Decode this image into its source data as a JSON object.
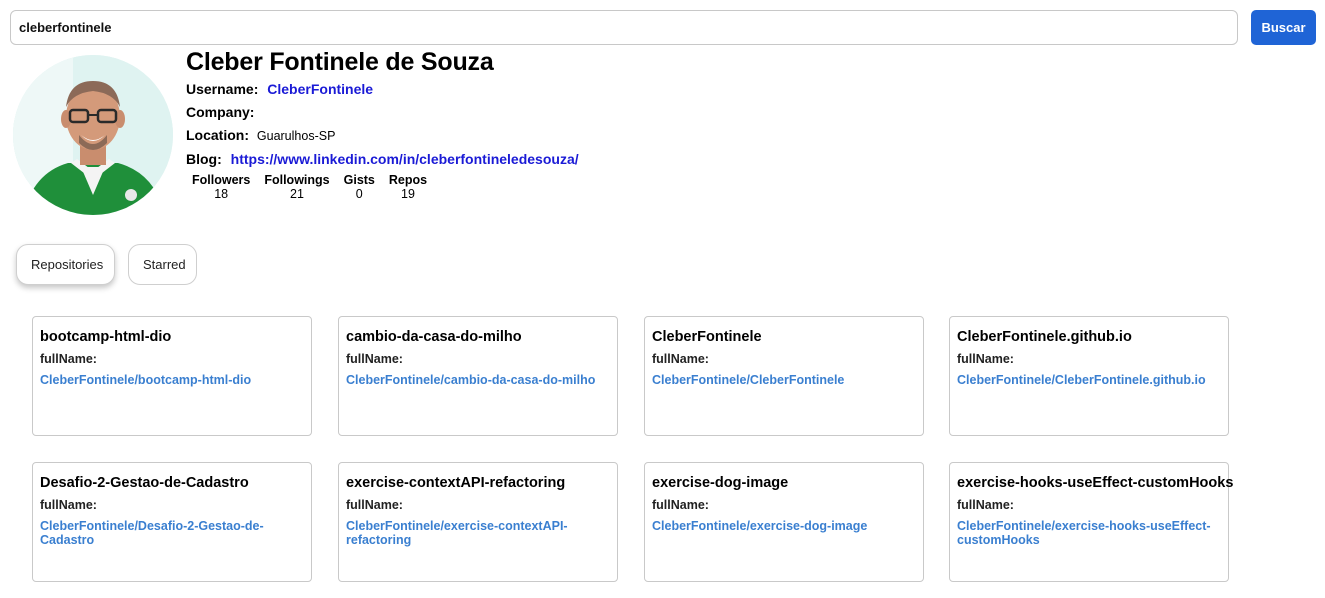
{
  "search": {
    "value": "cleberfontinele",
    "placeholder": "",
    "button_label": "Buscar"
  },
  "profile": {
    "name": "Cleber Fontinele de Souza",
    "username_label": "Username:",
    "username": "CleberFontinele",
    "company_label": "Company:",
    "company": "",
    "location_label": "Location:",
    "location": "Guarulhos-SP",
    "blog_label": "Blog:",
    "blog": "https://www.linkedin.com/in/cleberfontineledesouza/"
  },
  "stats": [
    {
      "label": "Followers",
      "value": "18"
    },
    {
      "label": "Followings",
      "value": "21"
    },
    {
      "label": "Gists",
      "value": "0"
    },
    {
      "label": "Repos",
      "value": "19"
    }
  ],
  "tabs": [
    {
      "label": "Repositories",
      "active": true
    },
    {
      "label": "Starred",
      "active": false
    }
  ],
  "repos": [
    {
      "name": "bootcamp-html-dio",
      "full_label": "fullName:",
      "full_name": "CleberFontinele/bootcamp-html-dio"
    },
    {
      "name": "cambio-da-casa-do-milho",
      "full_label": "fullName:",
      "full_name": "CleberFontinele/cambio-da-casa-do-milho"
    },
    {
      "name": "CleberFontinele",
      "full_label": "fullName:",
      "full_name": "CleberFontinele/CleberFontinele"
    },
    {
      "name": "CleberFontinele.github.io",
      "full_label": "fullName:",
      "full_name": "CleberFontinele/CleberFontinele.github.io"
    },
    {
      "name": "Desafio-2-Gestao-de-Cadastro",
      "full_label": "fullName:",
      "full_name": "CleberFontinele/Desafio-2-Gestao-de-Cadastro"
    },
    {
      "name": "exercise-contextAPI-refactoring",
      "full_label": "fullName:",
      "full_name": "CleberFontinele/exercise-contextAPI-refactoring"
    },
    {
      "name": "exercise-dog-image",
      "full_label": "fullName:",
      "full_name": "CleberFontinele/exercise-dog-image"
    },
    {
      "name": "exercise-hooks-useEffect-customHooks",
      "full_label": "fullName:",
      "full_name": "CleberFontinele/exercise-hooks-useEffect-customHooks"
    }
  ],
  "colors": {
    "accent": "#1f64d6",
    "link": "#1a1ad6",
    "repo_link": "#3a7fd0"
  }
}
